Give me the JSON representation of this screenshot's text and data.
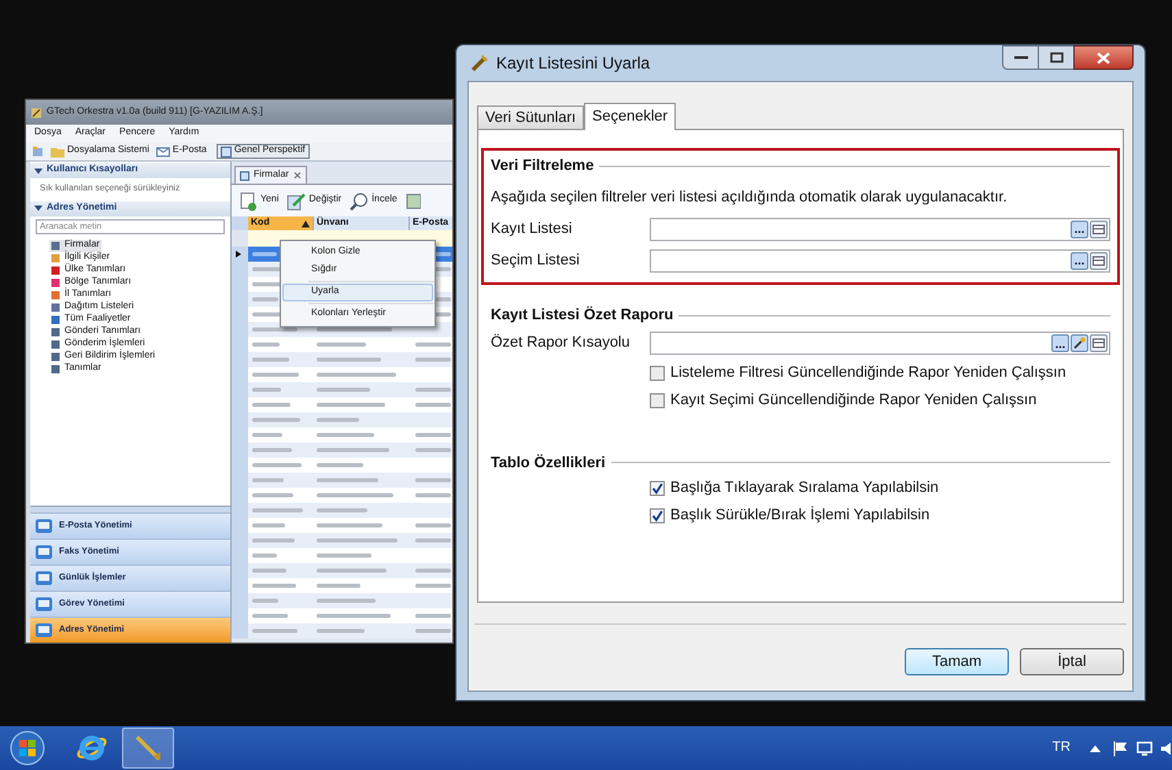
{
  "background_window": {
    "title": "GTech Orkestra v1.0a (build 911) [G-YAZILIM A.Ş.]",
    "menu": [
      "Dosya",
      "Araçlar",
      "Pencere",
      "Yardım"
    ],
    "toolbar": [
      {
        "kind": "folder",
        "label": "Dosyalama Sistemi"
      },
      {
        "kind": "mail",
        "label": "E-Posta"
      }
    ],
    "perspective": "Genel Perspektif",
    "sidebar": {
      "sections": [
        {
          "title": "Kullanıcı Kısayolları",
          "hint": "Sık kullanılan seçeneği sürükleyiniz"
        },
        {
          "title": "Adres Yönetimi",
          "search_placeholder": "Aranacak metin"
        }
      ],
      "items": [
        {
          "label": "Firmalar",
          "selected": true,
          "color": "#5a6f8f"
        },
        {
          "label": "İlgili Kişiler",
          "selected": false,
          "color": "#e0a040"
        },
        {
          "label": "Ülke Tanımları",
          "selected": false,
          "color": "#d02020"
        },
        {
          "label": "Bölge Tanımları",
          "selected": false,
          "color": "#e03070"
        },
        {
          "label": "İl Tanımları",
          "selected": false,
          "color": "#e07030"
        },
        {
          "label": "Dağıtım Listeleri",
          "selected": false,
          "color": "#6070a0"
        },
        {
          "label": "Tüm Faaliyetler",
          "selected": false,
          "color": "#3070c0"
        },
        {
          "label": "Gönderi Tanımları",
          "selected": false,
          "color": "#506a8a"
        },
        {
          "label": "Gönderim İşlemleri",
          "selected": false,
          "color": "#506a8a"
        },
        {
          "label": "Geri Bildirim İşlemleri",
          "selected": false,
          "color": "#506a8a"
        },
        {
          "label": "Tanımlar",
          "selected": false,
          "color": "#506a8a"
        }
      ],
      "nav": [
        {
          "label": "E-Posta Yönetimi",
          "selected": false
        },
        {
          "label": "Faks Yönetimi",
          "selected": false
        },
        {
          "label": "Günlük İşlemler",
          "selected": false
        },
        {
          "label": "Görev Yönetimi",
          "selected": false
        },
        {
          "label": "Adres Yönetimi",
          "selected": true
        }
      ]
    },
    "editor_tab": "Firmalar",
    "grid_toolbar": [
      {
        "kind": "new",
        "label": "Yeni"
      },
      {
        "kind": "edit",
        "label": "Değiştir"
      },
      {
        "kind": "view",
        "label": "İncele"
      }
    ],
    "columns": [
      {
        "label": "Kod",
        "sorted": true
      },
      {
        "label": "Ünvanı",
        "sorted": false
      },
      {
        "label": "E-Posta",
        "sorted": false
      }
    ],
    "context_menu": [
      {
        "label": "Kolon Gizle",
        "selected": false
      },
      {
        "label": "Sığdır",
        "selected": false
      },
      {
        "label": "Uyarla",
        "selected": true
      },
      {
        "label": "Kolonları Yerleştir",
        "selected": false
      }
    ]
  },
  "dialog": {
    "title": "Kayıt Listesini Uyarla",
    "tabs": [
      {
        "label": "Veri Sütunları",
        "selected": false
      },
      {
        "label": "Seçenekler",
        "selected": true
      }
    ],
    "sections": [
      {
        "title": "Veri Filtreleme",
        "highlighted": true,
        "description": "Aşağıda seçilen filtreler veri listesi açıldığında otomatik olarak uygulanacaktır.",
        "fields": [
          {
            "label": "Kayıt Listesi",
            "buttons": [
              {
                "kind": "browse",
                "label": "..."
              },
              {
                "kind": "clear"
              }
            ]
          },
          {
            "label": "Seçim Listesi",
            "buttons": [
              {
                "kind": "browse",
                "label": "..."
              },
              {
                "kind": "clear"
              }
            ]
          }
        ]
      },
      {
        "title": "Kayıt Listesi Özet Raporu",
        "highlighted": false,
        "fields": [
          {
            "label": "Özet Rapor Kısayolu",
            "buttons": [
              {
                "kind": "browse",
                "label": "..."
              },
              {
                "kind": "wand"
              },
              {
                "kind": "clear"
              }
            ]
          }
        ],
        "checkboxes": [
          {
            "label": "Listeleme Filtresi Güncellendiğinde Rapor Yeniden Çalışsın",
            "checked": false
          },
          {
            "label": "Kayıt Seçimi Güncellendiğinde Rapor Yeniden Çalışsın",
            "checked": false
          }
        ]
      },
      {
        "title": "Tablo Özellikleri",
        "highlighted": false,
        "checkboxes": [
          {
            "label": "Başlığa Tıklayarak Sıralama Yapılabilsin",
            "checked": true
          },
          {
            "label": "Başlık Sürükle/Bırak İşlemi Yapılabilsin",
            "checked": true
          }
        ]
      }
    ],
    "buttons": [
      {
        "label": "Tamam",
        "default": true
      },
      {
        "label": "İptal",
        "default": false
      }
    ]
  },
  "taskbar": {
    "language": "TR"
  }
}
